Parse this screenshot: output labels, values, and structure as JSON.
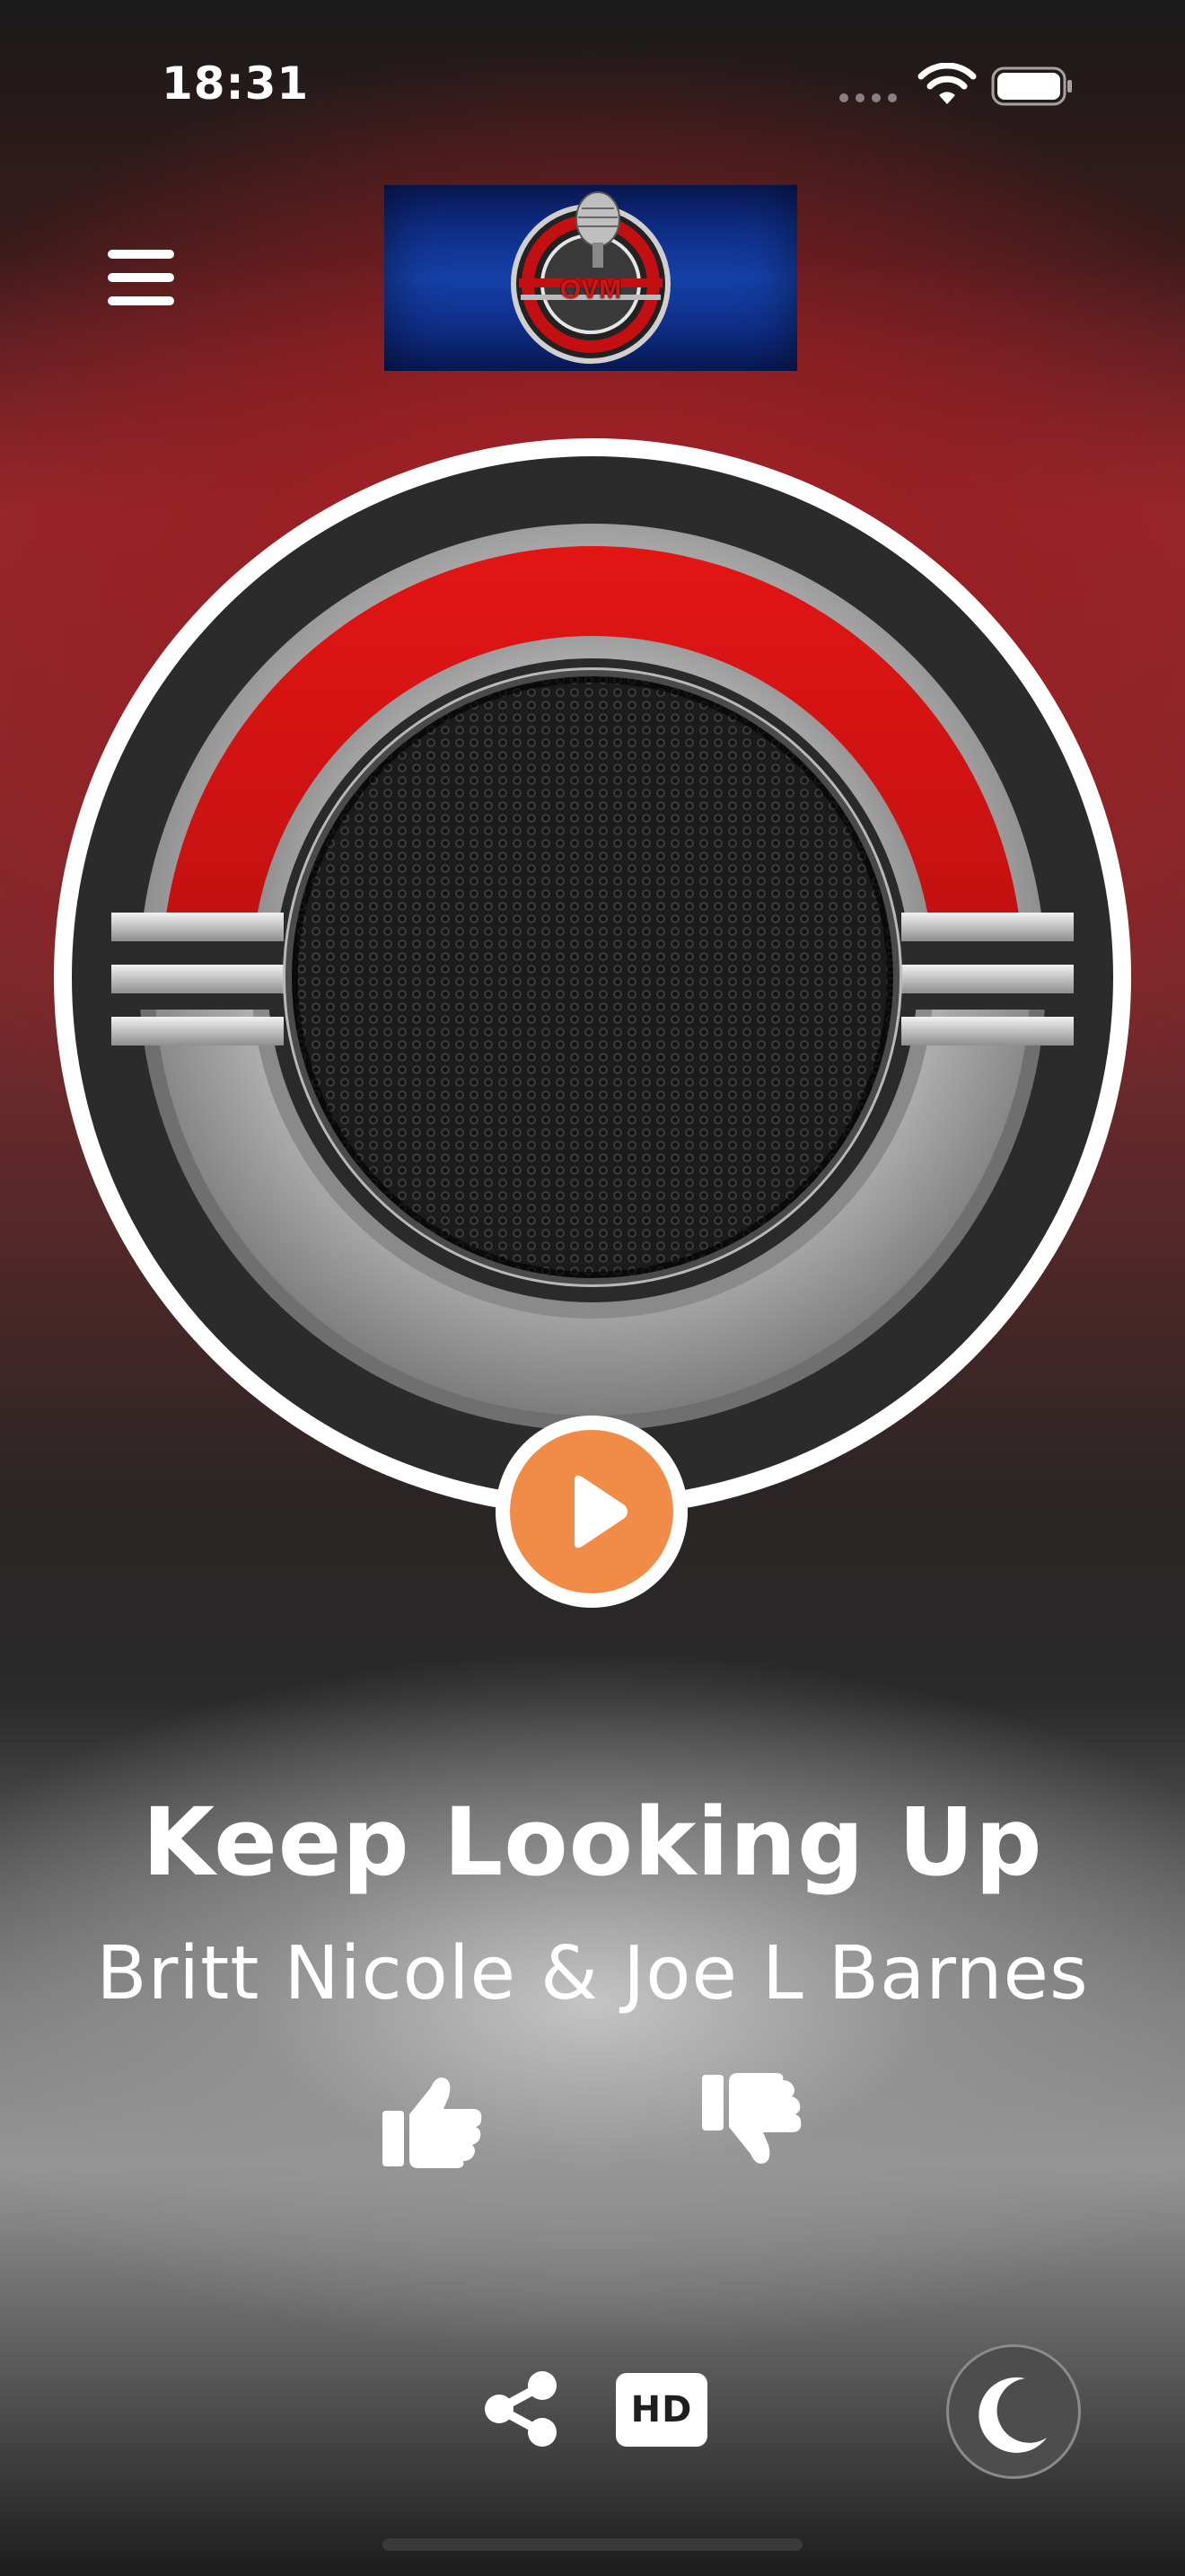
{
  "status_bar": {
    "time": "18:31",
    "icons": [
      "signal-icon",
      "wifi-icon",
      "battery-icon"
    ]
  },
  "header": {
    "menu_icon": "hamburger-menu-icon",
    "logo_text": "OVM"
  },
  "player": {
    "play_icon": "play-icon",
    "track_title": "Keep Looking Up",
    "track_artist": "Britt Nicole & Joe L Barnes",
    "like_icon": "thumbs-up-icon",
    "dislike_icon": "thumbs-down-icon"
  },
  "bottom_controls": {
    "share_icon": "share-icon",
    "hd_label": "HD",
    "sleep_icon": "moon-icon"
  },
  "colors": {
    "accent": "#f08c48",
    "brand_red": "#c40f12",
    "logo_blue": "#1440a8"
  }
}
